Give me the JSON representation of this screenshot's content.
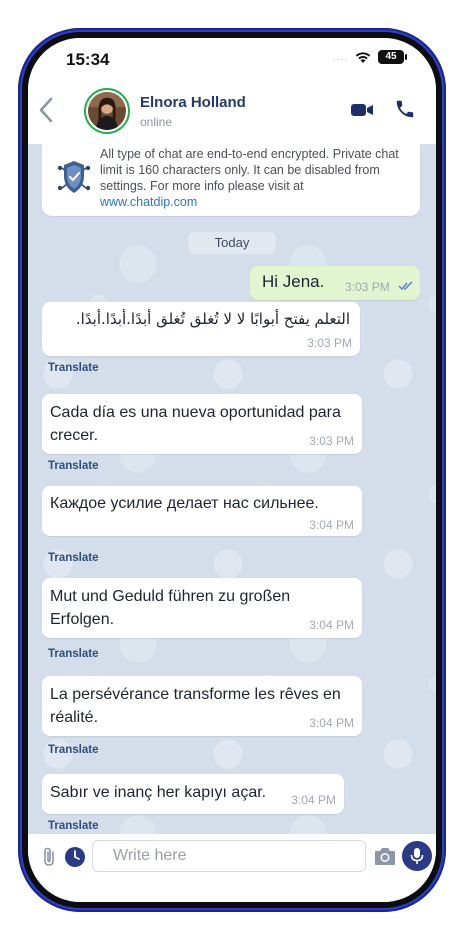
{
  "status_bar": {
    "time": "15:34",
    "signal": "....",
    "battery": "45"
  },
  "header": {
    "contact_name": "Elnora Holland",
    "contact_status": "online"
  },
  "encryption_notice": {
    "text": "All type of chat are end-to-end encrypted. Private chat limit is 160 characters only. It can be disabled from settings. For more info please visit at",
    "link": "www.chatdip.com"
  },
  "date_separator": "Today",
  "messages": [
    {
      "direction": "out",
      "text": "Hi Jena.",
      "time": "3:03 PM",
      "read": true
    },
    {
      "direction": "in",
      "text": "التعلم يفتح أبوابًا لا لا تُغلق تُغلق أبدًا.أبدًا.أبدًا.",
      "time": "3:03 PM",
      "translate": "Translate"
    },
    {
      "direction": "in",
      "text": "Cada día es una nueva oportunidad para crecer.",
      "time": "3:03 PM",
      "translate": "Translate"
    },
    {
      "direction": "in",
      "text": "Каждое усилие делает нас сильнее.",
      "time": "3:04 PM",
      "translate": "Translate"
    },
    {
      "direction": "in",
      "text": "Mut und Geduld führen zu großen Erfolgen.",
      "time": "3:04 PM",
      "translate": "Translate"
    },
    {
      "direction": "in",
      "text": "La persévérance transforme les rêves en réalité.",
      "time": "3:04 PM",
      "translate": "Translate"
    },
    {
      "direction": "in",
      "text": "Sabır ve inanç her kapıyı açar.",
      "time": "3:04 PM",
      "translate": "Translate"
    }
  ],
  "composer": {
    "placeholder": "Write here"
  },
  "colors": {
    "accent": "#2a3a86",
    "outgoing_bubble": "#e1f5d0",
    "avatar_ring": "#22b04b",
    "frame": "#2f3fc4"
  }
}
